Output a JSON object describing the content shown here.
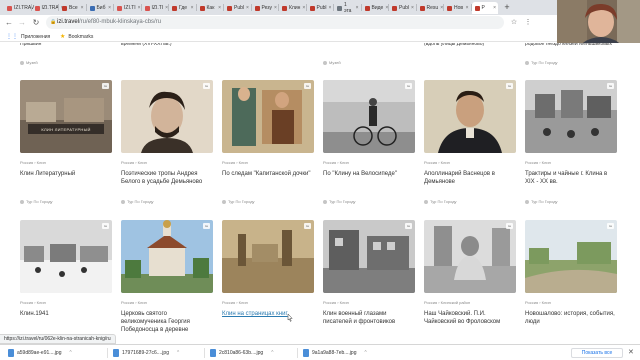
{
  "browser": {
    "tabs": [
      {
        "label": "IZI.TRAV",
        "color": "#d9534f"
      },
      {
        "label": "IZI.TRA",
        "color": "#d9534f"
      },
      {
        "label": "Все",
        "color": "#c0392b"
      },
      {
        "label": "Биб",
        "color": "#3b6db3"
      },
      {
        "label": "IZI.TI",
        "color": "#d9534f"
      },
      {
        "label": "IZI.TI",
        "color": "#d9534f"
      },
      {
        "label": "Где",
        "color": "#c0392b"
      },
      {
        "label": "Как",
        "color": "#c0392b"
      },
      {
        "label": "Publ",
        "color": "#c0392b"
      },
      {
        "label": "Резу",
        "color": "#c0392b"
      },
      {
        "label": "Клин",
        "color": "#c0392b"
      },
      {
        "label": "Publ",
        "color": "#c0392b"
      },
      {
        "label": "1 эта",
        "color": "#6c757d"
      },
      {
        "label": "Виде",
        "color": "#c0392b"
      },
      {
        "label": "Publ",
        "color": "#c0392b"
      },
      {
        "label": "Resu",
        "color": "#c0392b"
      },
      {
        "label": "Нов",
        "color": "#c0392b"
      },
      {
        "label": "Р",
        "color": "#c0392b"
      }
    ],
    "active_tab_index": 17,
    "new_tab": "+",
    "url_domain": "izi.travel",
    "url_path": "/ru/ef80-mbuk-klinskaya-cbs/ru",
    "nav": {
      "back": "←",
      "forward": "→",
      "reload": "↻"
    },
    "bookmarks": [
      {
        "label": "Приложения",
        "icon": "apps-grid-icon"
      },
      {
        "label": "Bookmarks",
        "icon": "star-icon"
      }
    ]
  },
  "top_row": {
    "texts": [
      "Пришвин",
      "времени (XVI-XXI вв.)",
      "",
      "",
      "(вдоль улицы Демьяново)",
      "родовое гнездо князей Меньшиковых"
    ],
    "authors": [
      "Музей",
      "",
      "",
      "Музей",
      "",
      "Тур По Городу"
    ]
  },
  "cards": [
    {
      "crumbs": "Россия  ›  Клин",
      "title": "Клин Литературный",
      "author": "Тур По Городу",
      "link": false
    },
    {
      "crumbs": "Россия  ›  Клин",
      "title": "Поэтические тропы Андрея Белого в усадьбе Демьяново",
      "author": "Тур По Городу",
      "link": false
    },
    {
      "crumbs": "Россия  ›  Клин",
      "title": "По следам \"Капитанской дочки\"",
      "author": "Тур По Городу",
      "link": false
    },
    {
      "crumbs": "Россия  ›  Клин",
      "title": "По \"Клину на Велосипеде\"",
      "author": "Тур По Городу",
      "link": false
    },
    {
      "crumbs": "Россия  ›  Клин",
      "title": "Аполлинарий Васнецов в Демьянове",
      "author": "Тур По Городу",
      "link": false
    },
    {
      "crumbs": "Россия  ›  Клин",
      "title": "Трактиры и чайные г. Клина в XIX - XX вв.",
      "author": "Тур По Городу",
      "link": false
    },
    {
      "crumbs": "Россия  ›  Клин",
      "title": "Клин.1941",
      "author": "",
      "link": false
    },
    {
      "crumbs": "Россия  ›  Клин",
      "title": "Церковь святого великомученика Георгия Победоносца в деревне",
      "author": "",
      "link": false
    },
    {
      "crumbs": "Россия  ›  Клин",
      "title": "Клин на страницах книг",
      "author": "",
      "link": true
    },
    {
      "crumbs": "Россия  ›  Клин",
      "title": "Клин военный глазами писателей и фронтовиков",
      "author": "",
      "link": false
    },
    {
      "crumbs": "Россия  ›  Клинский район",
      "title": "Наш Чайковский. П.И. Чайковский во Фроловском",
      "author": "",
      "link": false
    },
    {
      "crumbs": "Россия  ›  Клин",
      "title": "Новошалово: история, события, люди",
      "author": "",
      "link": false
    }
  ],
  "thumb_badge": "ru",
  "thumb_overlay_text": "КЛИН ЛИТЕРАТУРНЫЙ",
  "status_url": "https://izi.travel/ru/062e-klin-na-stranicah-knig/ru",
  "downloads": {
    "items": [
      "a59d89ae-e91....jpg",
      "17971689-27c6....jpg",
      "2c810a86-63b....jpg",
      "9a1a9a88-7eb....jpg"
    ],
    "show_all": "Показать все",
    "close": "✕"
  }
}
